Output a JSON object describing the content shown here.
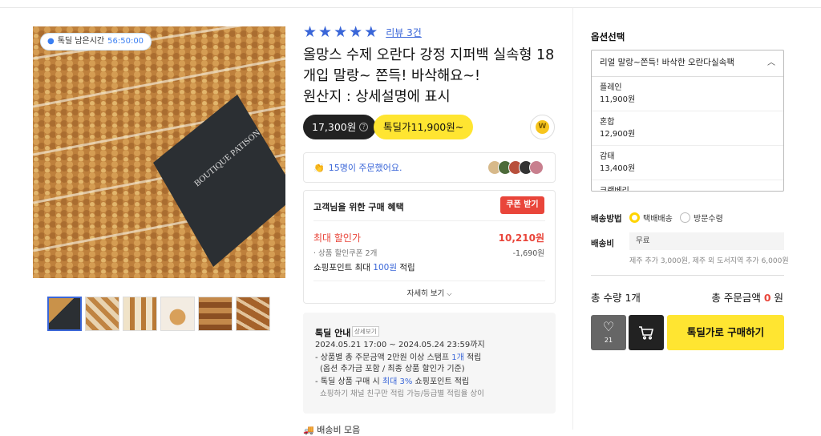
{
  "timer": {
    "label": "톡딜 남은시간",
    "time": "56:50:00"
  },
  "product": {
    "review_link": "리뷰 3건",
    "title_line1": "올망스 수제 오란다 강정 지퍼백 실속형 18",
    "title_line2": "개입 말랑~ 쫀득! 바삭해요~!",
    "title_line3": "원산지 : 상세설명에 표시",
    "rating_stars": 5,
    "price_regular": "17,300원",
    "price_deal": "톡딜가11,900원~",
    "wallet_icon": "W"
  },
  "orders": {
    "text": "15명이 주문했어요."
  },
  "benefit": {
    "title": "고객님을 위한 구매 혜택",
    "coupon_button": "쿠폰 받기",
    "max_discount_label": "최대 할인가",
    "max_discount_value": "10,210원",
    "coupon_label": "· 상품 할인쿠폰 2개",
    "coupon_value": "-1,690원",
    "points_prefix": "쇼핑포인트 최대 ",
    "points_value": "100원",
    "points_suffix": " 적립",
    "more": "자세히 보기"
  },
  "deal": {
    "title": "톡딜 안내",
    "detail_tag": "상세보기",
    "period": "2024.05.21 17:00 ~ 2024.05.24 23:59까지",
    "line1a": "- 상품별 총 주문금액 2만원 이상 스탬프 ",
    "line1b": "1개",
    "line1c": " 적립",
    "line2": "(옵션 추가금 포함 / 최종 상품 할인가 기준)",
    "line3a": "- 톡딜 상품 구매 시 ",
    "line3b": "최대 3%",
    "line3c": " 쇼핑포인트 적립",
    "line4": "쇼핑하기 채널 친구만 적립 가능/등급별 적립율 상이"
  },
  "shipping_bottom": "배송비 모음",
  "options": {
    "title": "옵션선택",
    "selected": "리얼 말랑~쫀득! 바삭한 오란다실속팩",
    "items": [
      {
        "name": "플레인",
        "price": "11,900원"
      },
      {
        "name": "혼합",
        "price": "12,900원"
      },
      {
        "name": "감태",
        "price": "13,400원"
      },
      {
        "name": "크랜베리",
        "price": ""
      }
    ]
  },
  "delivery": {
    "method_label": "배송방법",
    "method_1": "택배배송",
    "method_2": "방문수령",
    "fee_label": "배송비",
    "fee_value": "무료",
    "fee_note": "제주 추가 3,000원, 제주 외 도서지역 추가 6,000원"
  },
  "summary": {
    "total_qty": "총 수량 1개",
    "total_price_label": "총 주문금액 ",
    "total_price_value": "0",
    "total_price_unit": " 원",
    "likes": "21",
    "buy_button": "톡딜가로 구매하기"
  },
  "colors": {
    "accent": "#3a66d8",
    "deal_yellow": "#ffe531",
    "red": "#e9453a"
  }
}
